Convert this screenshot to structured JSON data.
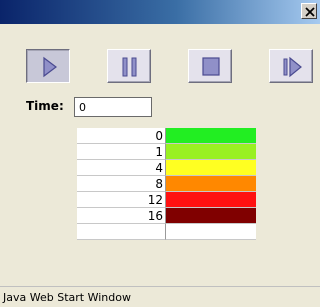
{
  "window": {
    "title": "",
    "status_text": "Java Web Start Window"
  },
  "controls": {
    "buttons": [
      {
        "name": "play",
        "icon": "play-icon",
        "selected": true
      },
      {
        "name": "pause",
        "icon": "pause-icon",
        "selected": false
      },
      {
        "name": "stop",
        "icon": "stop-icon",
        "selected": false
      },
      {
        "name": "step",
        "icon": "step-forward-icon",
        "selected": false
      }
    ]
  },
  "time": {
    "label": "Time:",
    "value": "0"
  },
  "legend": {
    "rows": [
      {
        "value": "0",
        "color": "#22ee22"
      },
      {
        "value": "1",
        "color": "#99f022"
      },
      {
        "value": "4",
        "color": "#ffff22"
      },
      {
        "value": "8",
        "color": "#ff8800"
      },
      {
        "value": "12",
        "color": "#ff1111"
      },
      {
        "value": "16",
        "color": "#800000"
      },
      {
        "value": "",
        "color": "#ffffff"
      }
    ]
  },
  "colors": {
    "icon": "#5a5aa0",
    "icon_fill": "#7070b8"
  }
}
